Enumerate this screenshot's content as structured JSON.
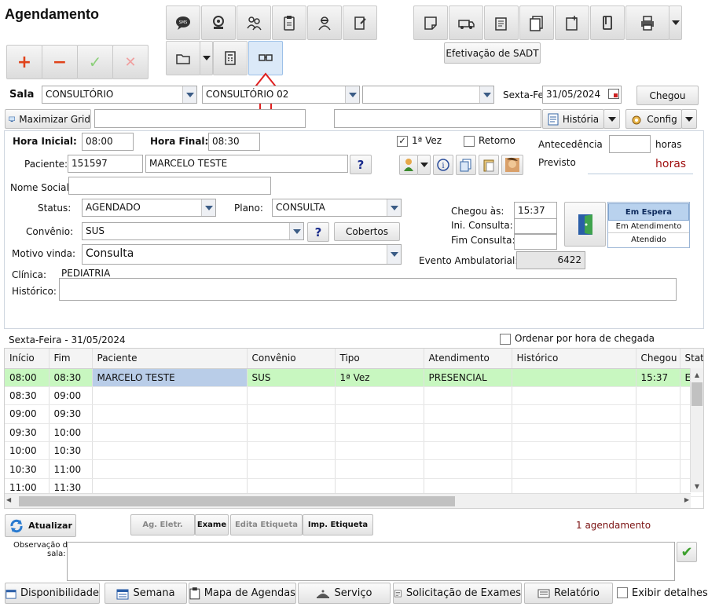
{
  "page_title": "Agendamento",
  "sadt_button": "Efetivação de SADT",
  "sala": {
    "label": "Sala",
    "select1": "CONSULTÓRIO",
    "select2": "CONSULTÓRIO 02",
    "select3": "",
    "date_label": "Sexta-Fei",
    "date_value": "31/05/2024",
    "chegou_button": "Chegou"
  },
  "toolbar2": {
    "maximizar": "Maximizar Grid",
    "historia": "História",
    "config": "Config"
  },
  "form": {
    "hora_inicial_label": "Hora Inicial:",
    "hora_inicial": "08:00",
    "hora_final_label": "Hora Final:",
    "hora_final": "08:30",
    "primeira_vez_label": "1ª Vez",
    "retorno_label": "Retorno",
    "antecedencia_label": "Antecedência",
    "horas_label": "horas",
    "previsto_label": "Previsto",
    "previsto_value": "horas",
    "paciente_label": "Paciente:",
    "paciente_id": "151597",
    "paciente_nome": "MARCELO TESTE",
    "nome_social_label": "Nome Social:",
    "status_label": "Status:",
    "status_value": "AGENDADO",
    "plano_label": "Plano:",
    "plano_value": "CONSULTA",
    "convenio_label": "Convênio:",
    "convenio_value": "SUS",
    "cobertos_button": "Cobertos",
    "motivo_label": "Motivo vinda:",
    "motivo_value": "Consulta",
    "clinica_label": "Clínica:",
    "clinica_value": "PEDIATRIA",
    "historico_label": "Histórico:",
    "chegou_as_label": "Chegou às:",
    "chegou_as_value": "15:37",
    "ini_consulta_label": "Ini. Consulta:",
    "fim_consulta_label": "Fim Consulta:",
    "evento_label": "Evento Ambulatorial:",
    "evento_value": "6422",
    "status_list": [
      "Em Espera",
      "Em Atendimento",
      "Atendido"
    ]
  },
  "grid": {
    "date_caption": "Sexta-Feira - 31/05/2024",
    "ordenar_label": "Ordenar por hora de chegada",
    "columns": [
      "Início",
      "Fim",
      "Paciente",
      "Convênio",
      "Tipo",
      "Atendimento",
      "Histórico",
      "Chegou",
      "Stat"
    ],
    "rows": [
      [
        "08:00",
        "08:30",
        "MARCELO TESTE",
        "SUS",
        "1ª Vez",
        "PRESENCIAL",
        "",
        "15:37",
        "E"
      ],
      [
        "08:30",
        "09:00",
        "",
        "",
        "",
        "",
        "",
        "",
        ""
      ],
      [
        "09:00",
        "09:30",
        "",
        "",
        "",
        "",
        "",
        "",
        ""
      ],
      [
        "09:30",
        "10:00",
        "",
        "",
        "",
        "",
        "",
        "",
        ""
      ],
      [
        "10:00",
        "10:30",
        "",
        "",
        "",
        "",
        "",
        "",
        ""
      ],
      [
        "10:30",
        "11:00",
        "",
        "",
        "",
        "",
        "",
        "",
        ""
      ],
      [
        "11:00",
        "11:30",
        "",
        "",
        "",
        "",
        "",
        "",
        ""
      ]
    ]
  },
  "bottom": {
    "atualizar": "Atualizar",
    "ag_eletr": "Ag. Eletr.",
    "exame": "Exame",
    "edita_etiqueta": "Edita Etiqueta",
    "imp_etiqueta": "Imp. Etiqueta",
    "count": "1 agendamento",
    "observacao_label_1": "Observação da",
    "observacao_label_2": "sala:",
    "tabs": [
      "Disponibilidade",
      "Semana",
      "Mapa de Agendas",
      "Serviço",
      "Solicitação de Exames",
      "Relatório"
    ],
    "exibir_detalhes": "Exibir detalhes"
  },
  "colors": {
    "accent_red_arrow": "#e02020",
    "selected_row": "#c8f7c0",
    "selected_cell": "#b9cde8",
    "em_espera_bg": "#b9d2ee",
    "previsto_text": "#a01010",
    "count_text": "#7a1010"
  }
}
